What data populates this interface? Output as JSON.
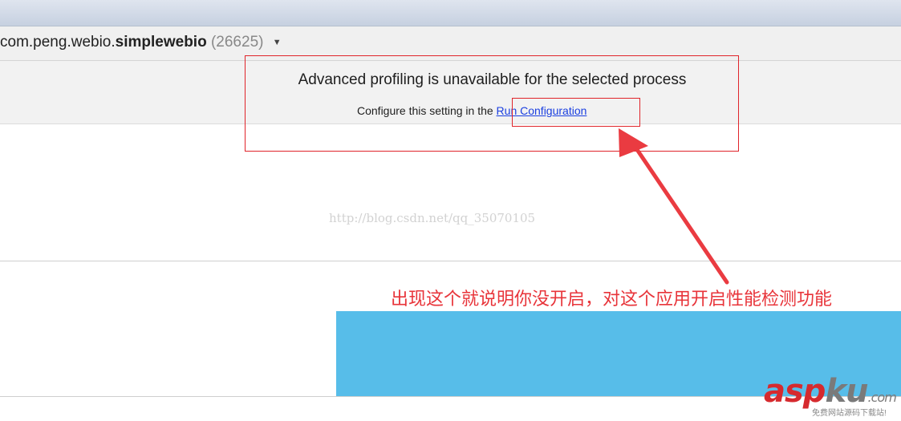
{
  "process": {
    "package_prefix": "com.peng.webio.",
    "package_app": "simplewebio",
    "pid": "(26625)",
    "dropdown_icon": "caret-down-icon"
  },
  "notice": {
    "title": "Advanced profiling is unavailable for the selected process",
    "text_prefix": "Configure this setting in the ",
    "link_text": "Run Configuration"
  },
  "watermark": {
    "url": "http://blog.csdn.net/qq_35070105"
  },
  "annotation": {
    "text": "出现这个就说明你没开启，对这个应用开启性能检测功能",
    "color": "#e8343a"
  },
  "logo": {
    "asp": "asp",
    "ku": "ku",
    "tld": ".com",
    "tagline": "免费网站源码下载站!"
  },
  "colors": {
    "chart_fill": "#57bde9",
    "highlight": "#e0242a",
    "link": "#1a3fe0"
  }
}
